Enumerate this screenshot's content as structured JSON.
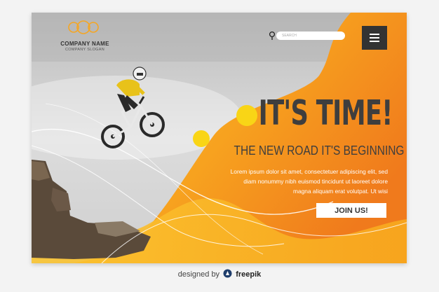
{
  "company": {
    "name": "COMPANY NAME",
    "slogan": "COMPANY SLOGAN"
  },
  "search": {
    "placeholder": "SEARCH"
  },
  "menu": {
    "icon": "hamburger-menu-icon"
  },
  "hero": {
    "title": "IT'S TIME!",
    "subtitle": "THE NEW ROAD IT'S BEGINNING",
    "body_lines": [
      "Lorem ipsum dolor sit amet, consectetuer adipiscing elit, sed",
      "diam nonummy nibh euismod tincidunt ut laoreet dolore",
      "magna aliquam erat volutpat. Ut wisi"
    ],
    "cta_label": "JOIN US!"
  },
  "footer": {
    "prefix": "designed by",
    "brand": "freepik"
  },
  "colors": {
    "accent": "#f5a623",
    "accent_dark": "#f07e1a",
    "yellow": "#f9d516",
    "dark": "#3e3e3e"
  }
}
